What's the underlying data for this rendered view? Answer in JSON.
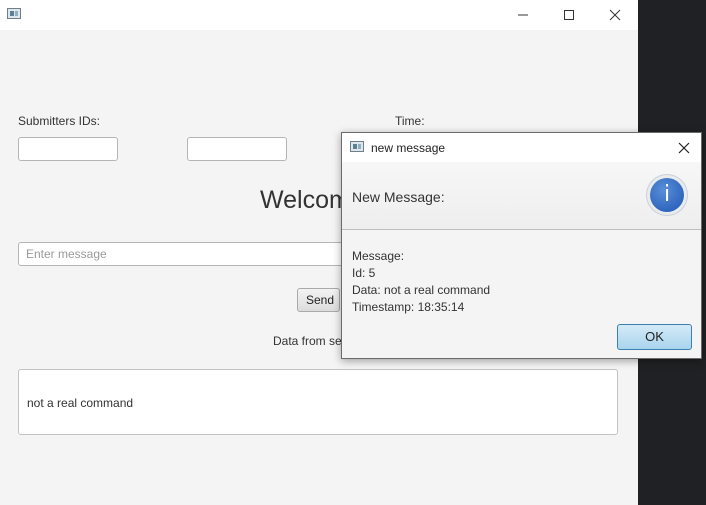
{
  "main_window": {
    "title": "",
    "controls": {
      "minimize": "—",
      "maximize": "☐",
      "close": "✕"
    },
    "labels": {
      "submitters_ids": "Submitters IDs:",
      "time": "Time:"
    },
    "submitter_id_1": "",
    "submitter_id_2": "",
    "welcome": "Welcome",
    "message_input": {
      "value": "",
      "placeholder": "Enter message"
    },
    "send_button": "Send",
    "data_from_server_label": "Data from server:",
    "server_data": "not a real command"
  },
  "dialog": {
    "title": "new message",
    "header": "New Message:",
    "icon": "info-icon",
    "content": {
      "line1": "Message:",
      "line2": "Id: 5",
      "line3": "Data: not a real command",
      "line4": "Timestamp: 18:35:14"
    },
    "ok_button": "OK"
  },
  "colors": {
    "window_bg": "#f4f4f4",
    "desktop_bg": "#202124",
    "ok_button": "#a9d4ee",
    "info_icon": "#1e56b4"
  }
}
